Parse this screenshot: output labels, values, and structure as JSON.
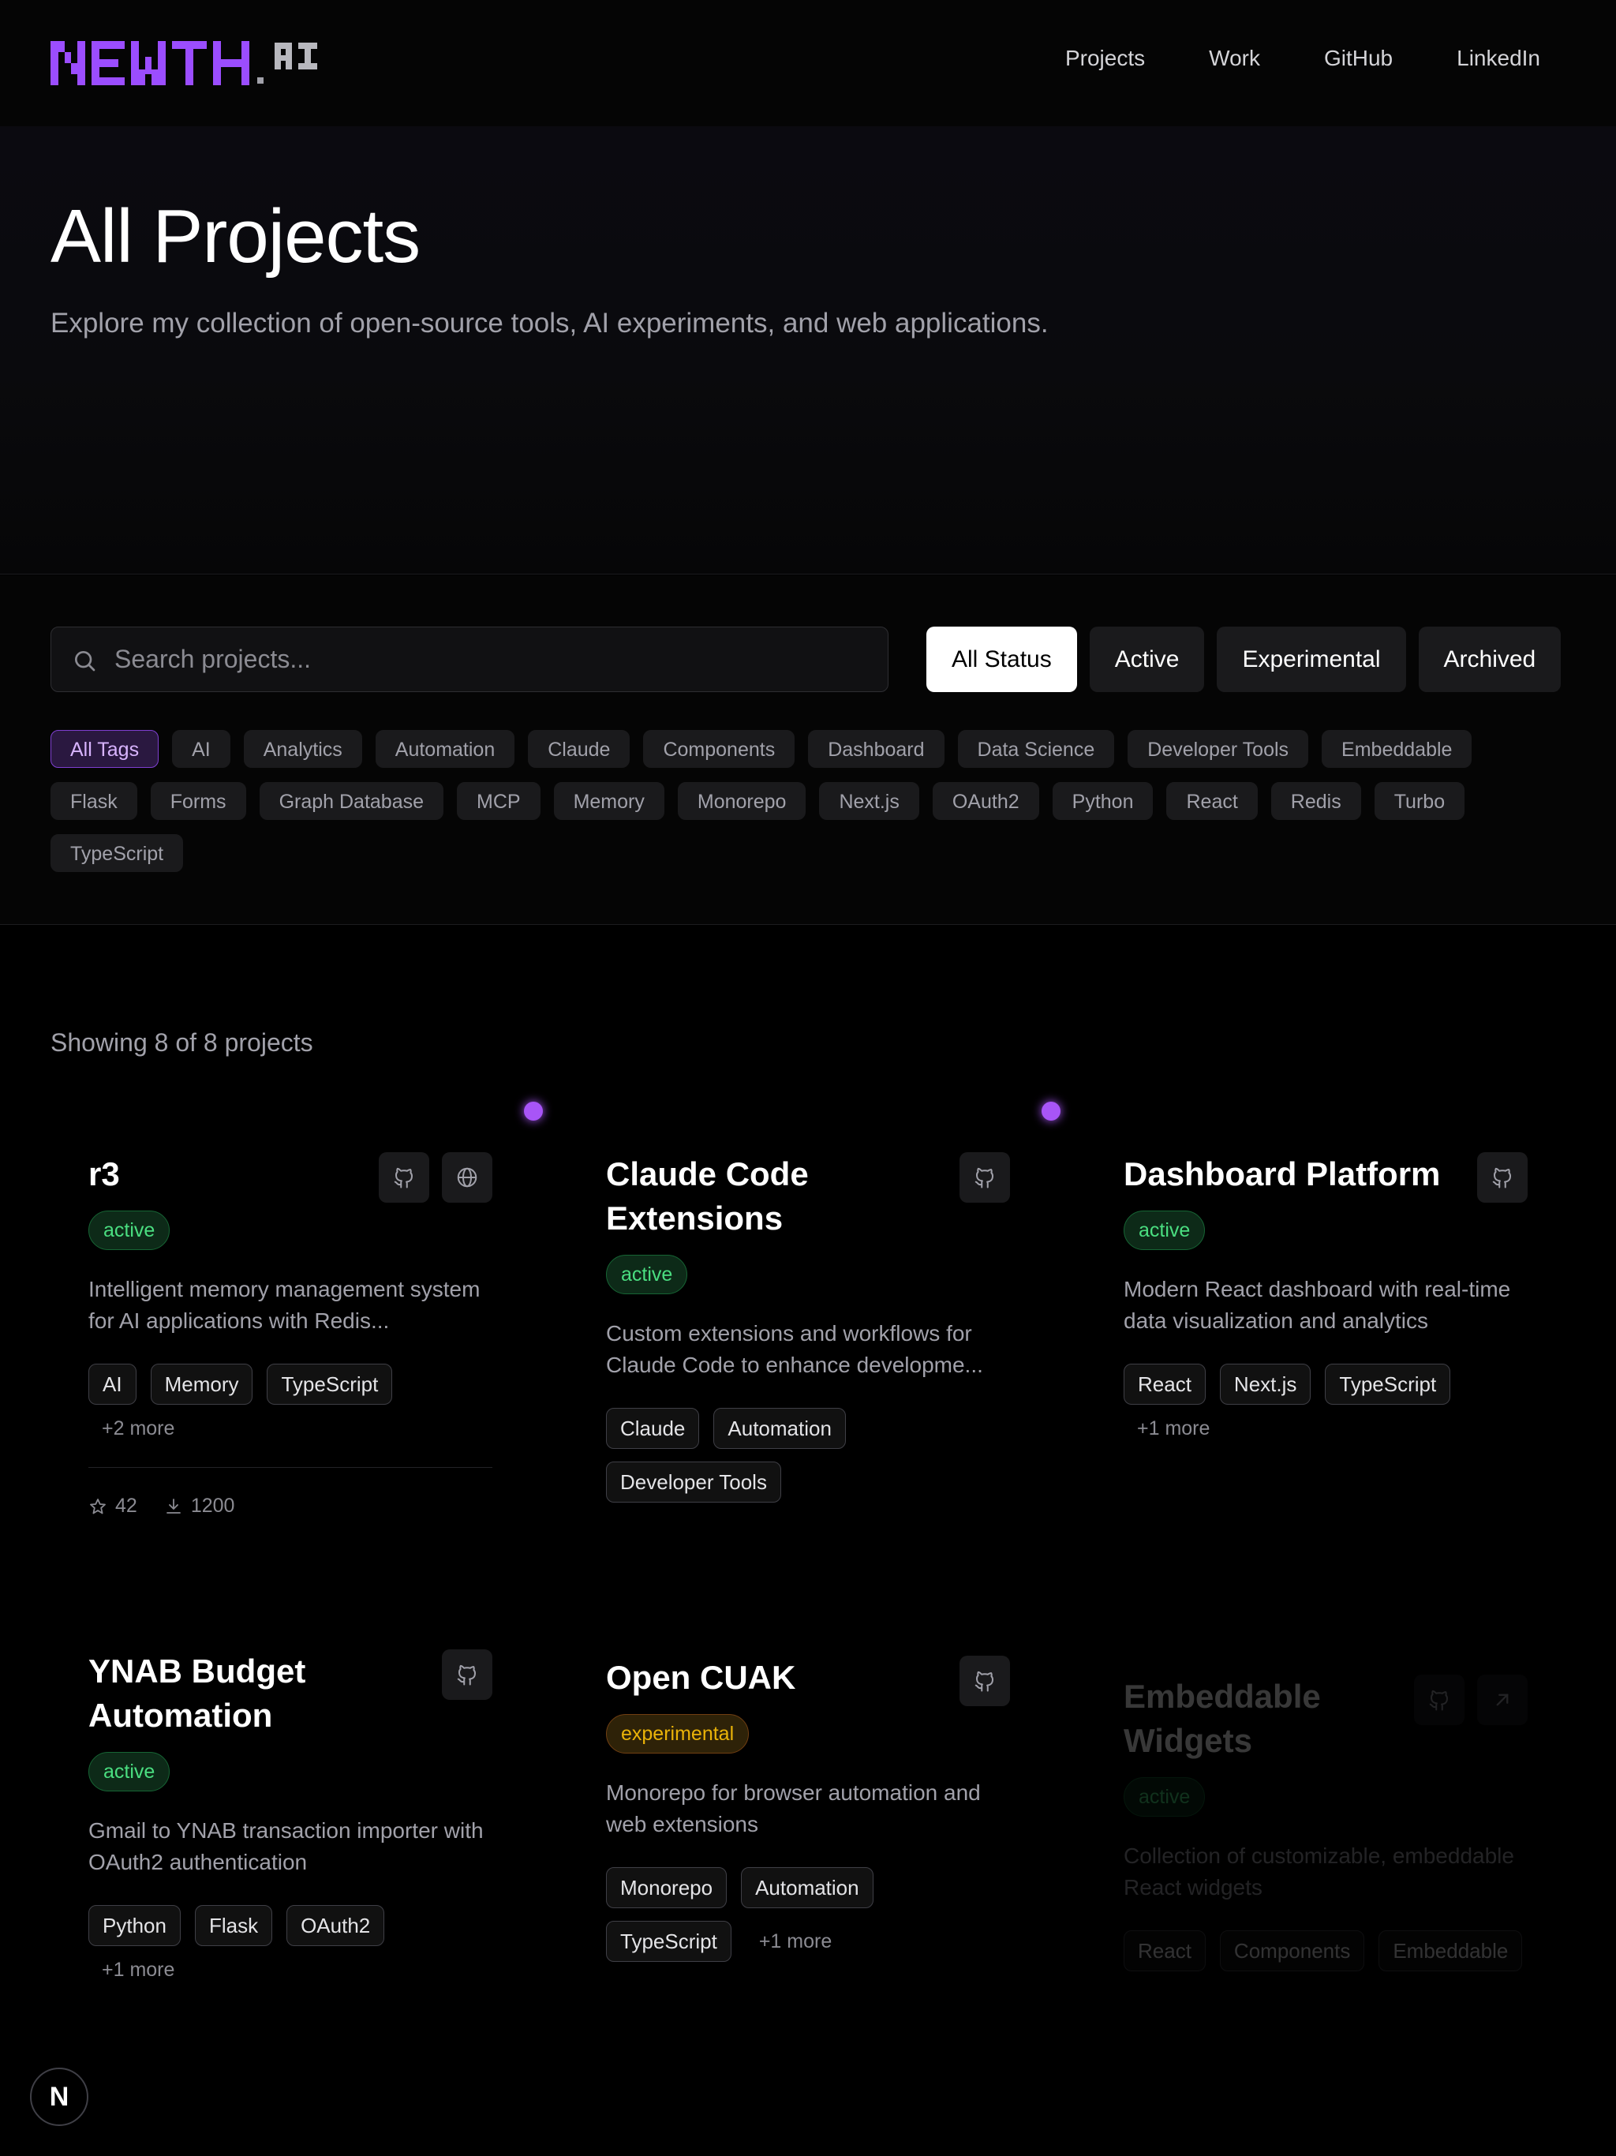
{
  "brand": {
    "logo_text": "NEWTH",
    "logo_suffix": "AI"
  },
  "nav": [
    {
      "label": "Projects"
    },
    {
      "label": "Work"
    },
    {
      "label": "GitHub"
    },
    {
      "label": "LinkedIn"
    }
  ],
  "hero": {
    "title": "All Projects",
    "subtitle": "Explore my collection of open-source tools, AI experiments, and web applications."
  },
  "search": {
    "placeholder": "Search projects...",
    "value": ""
  },
  "status_filters": [
    "All Status",
    "Active",
    "Experimental",
    "Archived"
  ],
  "status_selected": "All Status",
  "tags": [
    "All Tags",
    "AI",
    "Analytics",
    "Automation",
    "Claude",
    "Components",
    "Dashboard",
    "Data Science",
    "Developer Tools",
    "Embeddable",
    "Flask",
    "Forms",
    "Graph Database",
    "MCP",
    "Memory",
    "Monorepo",
    "Next.js",
    "OAuth2",
    "Python",
    "React",
    "Redis",
    "Turbo",
    "TypeScript"
  ],
  "tag_selected": "All Tags",
  "results": {
    "showing": "Showing 8 of 8 projects"
  },
  "projects": [
    {
      "title": "r3",
      "status": "active",
      "description": "Intelligent memory management system for AI applications with Redis...",
      "tags": [
        "AI",
        "Memory",
        "TypeScript"
      ],
      "more": "+2 more",
      "icons": [
        "github-icon",
        "globe-icon"
      ],
      "stars": "42",
      "downloads": "1200"
    },
    {
      "title": "Claude Code Extensions",
      "status": "active",
      "description": "Custom extensions and workflows for Claude Code to enhance developme...",
      "tags": [
        "Claude",
        "Automation",
        "Developer Tools"
      ],
      "more": "",
      "icons": [
        "github-icon"
      ]
    },
    {
      "title": "Dashboard Platform",
      "status": "active",
      "description": "Modern React dashboard with real-time data visualization and analytics",
      "tags": [
        "React",
        "Next.js",
        "TypeScript"
      ],
      "more": "+1 more",
      "icons": [
        "github-icon"
      ]
    },
    {
      "title": "YNAB Budget Automation",
      "status": "active",
      "description": "Gmail to YNAB transaction importer with OAuth2 authentication",
      "tags": [
        "Python",
        "Flask",
        "OAuth2"
      ],
      "more": "+1 more",
      "icons": [
        "github-icon"
      ]
    },
    {
      "title": "Open CUAK",
      "status": "experimental",
      "description": "Monorepo for browser automation and web extensions",
      "tags": [
        "Monorepo",
        "Automation",
        "TypeScript"
      ],
      "more": "+1 more",
      "icons": [
        "github-icon"
      ]
    },
    {
      "title": "Embeddable Widgets",
      "status": "active",
      "description": "Collection of customizable, embeddable React widgets",
      "tags": [
        "React",
        "Components",
        "Embeddable"
      ],
      "more": "",
      "icons": [
        "github-icon",
        "external-link-icon"
      ]
    }
  ],
  "colors": {
    "accent": "#a855f7",
    "active_green": "#4ade80",
    "experimental_yellow": "#eab308",
    "background": "#000000"
  },
  "dev_badge": {
    "label": "N"
  }
}
